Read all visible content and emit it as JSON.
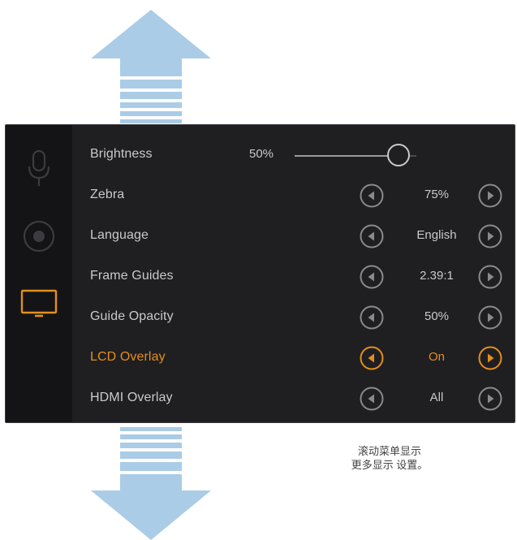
{
  "colors": {
    "accent": "#e48e1d",
    "panel_background": "#1f1f21",
    "sidebar_background": "#141416",
    "text": "#c9c9cb",
    "arrow_fill": "#aacce6"
  },
  "sidebar": {
    "tabs": [
      {
        "icon": "microphone-icon",
        "selected": false
      },
      {
        "icon": "record-icon",
        "selected": false
      },
      {
        "icon": "monitor-icon",
        "selected": true
      }
    ]
  },
  "settings": {
    "brightness": {
      "label": "Brightness",
      "value": "50%",
      "level": 0.85
    },
    "rows": [
      {
        "label": "Zebra",
        "value": "75%",
        "active": false
      },
      {
        "label": "Language",
        "value": "English",
        "active": false
      },
      {
        "label": "Frame Guides",
        "value": "2.39:1",
        "active": false
      },
      {
        "label": "Guide Opacity",
        "value": "50%",
        "active": false
      },
      {
        "label": "LCD Overlay",
        "value": "On",
        "active": true
      },
      {
        "label": "HDMI Overlay",
        "value": "All",
        "active": false
      }
    ]
  },
  "icons": {
    "prev": "chevron-left-icon",
    "next": "chevron-right-icon",
    "scroll_up": "arrow-up-icon",
    "scroll_down": "arrow-down-icon"
  },
  "caption": {
    "line1": "滚动菜单显示",
    "line2": "更多显示 设置。"
  }
}
